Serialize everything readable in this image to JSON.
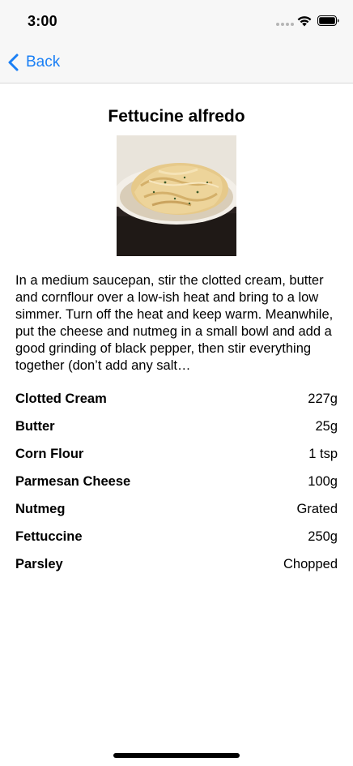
{
  "status_bar": {
    "time": "3:00",
    "icons": [
      "signal-dots-icon",
      "wifi-icon",
      "battery-icon"
    ]
  },
  "nav": {
    "back_label": "Back",
    "back_icon": "chevron-left-icon",
    "accent_color": "#1a7ff5"
  },
  "recipe": {
    "title": "Fettucine alfredo",
    "image_icon": "pasta-photo",
    "description": "In a medium saucepan, stir the clotted cream, butter and cornflour over a low-ish heat and bring to a low simmer. Turn off the heat and keep warm. Meanwhile, put the cheese and nutmeg in a small bowl and add a good grinding of black pepper, then stir everything together (don’t add any salt…",
    "ingredients": [
      {
        "name": "Clotted Cream",
        "amount": "227g"
      },
      {
        "name": "Butter",
        "amount": "25g"
      },
      {
        "name": "Corn Flour",
        "amount": "1 tsp"
      },
      {
        "name": "Parmesan Cheese",
        "amount": "100g"
      },
      {
        "name": "Nutmeg",
        "amount": "Grated"
      },
      {
        "name": "Fettuccine",
        "amount": "250g"
      },
      {
        "name": "Parsley",
        "amount": "Chopped"
      }
    ]
  }
}
